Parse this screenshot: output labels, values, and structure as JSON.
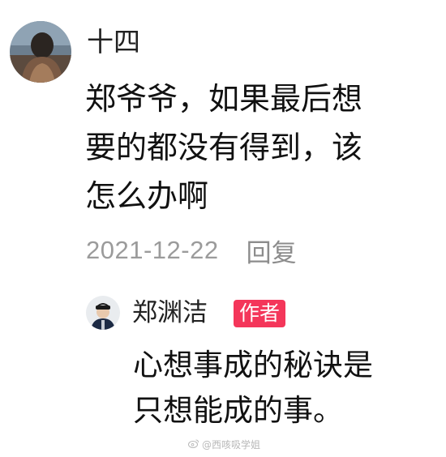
{
  "comment": {
    "user_name": "十四",
    "text_lines": [
      "郑爷爷，如果最后想",
      "要的都没有得到，该",
      "怎么办啊"
    ],
    "timestamp": "2021-12-22",
    "reply_label": "回复"
  },
  "reply": {
    "user_name": "郑渊洁",
    "badge": "作者",
    "text_lines": [
      "心想事成的秘诀是",
      "只想能成的事。"
    ]
  },
  "watermark": {
    "icon": "weibo-icon",
    "text": "@西咳吸学姐"
  },
  "colors": {
    "badge_bg": "#f4365a",
    "meta_text": "#9b9b9b",
    "primary_text": "#111111"
  }
}
